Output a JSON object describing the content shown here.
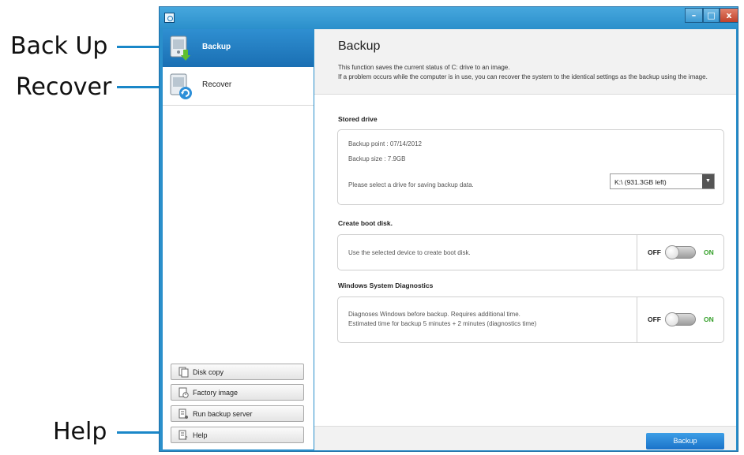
{
  "callouts": {
    "backup": "Back Up",
    "recover": "Recover",
    "help": "Help"
  },
  "window": {
    "controls": {
      "minimize": "–",
      "maximize": "□",
      "close": "x"
    }
  },
  "sidebar": {
    "items": [
      {
        "label": "Backup",
        "icon": "backup-drive-icon",
        "selected": true
      },
      {
        "label": "Recover",
        "icon": "recover-drive-icon",
        "selected": false
      }
    ],
    "buttons": [
      {
        "label": "Disk copy",
        "icon": "disk-copy-icon"
      },
      {
        "label": "Factory image",
        "icon": "factory-image-icon"
      },
      {
        "label": "Run backup server",
        "icon": "backup-server-icon"
      },
      {
        "label": "Help",
        "icon": "help-icon"
      }
    ]
  },
  "main": {
    "title": "Backup",
    "description_line1": "This function saves the current status of C: drive to an image.",
    "description_line2": "If a problem occurs while the computer is in use, you can recover the system to the identical settings as the backup using the image.",
    "stored_drive": {
      "title": "Stored drive",
      "backup_point": "Backup point : 07/14/2012",
      "backup_size": "Backup size : 7.9GB",
      "select_prompt": "Please select a drive for saving backup data.",
      "selected_drive": "K:\\ (931.3GB left)"
    },
    "boot_disk": {
      "title": "Create boot disk.",
      "text": "Use the selected device to create boot disk.",
      "off_label": "OFF",
      "on_label": "ON",
      "state": "off"
    },
    "diagnostics": {
      "title": "Windows System Diagnostics",
      "text_line1": "Diagnoses Windows before backup. Requires additional time.",
      "text_line2": "Estimated time for backup 5 minutes + 2 minutes (diagnostics time)",
      "off_label": "OFF",
      "on_label": "ON",
      "state": "off"
    },
    "backup_button": "Backup"
  },
  "colors": {
    "accent": "#1a6fb3",
    "titlebar": "#2b8fcb",
    "on_label": "#36a02b",
    "callout_line": "#1a87c8"
  }
}
